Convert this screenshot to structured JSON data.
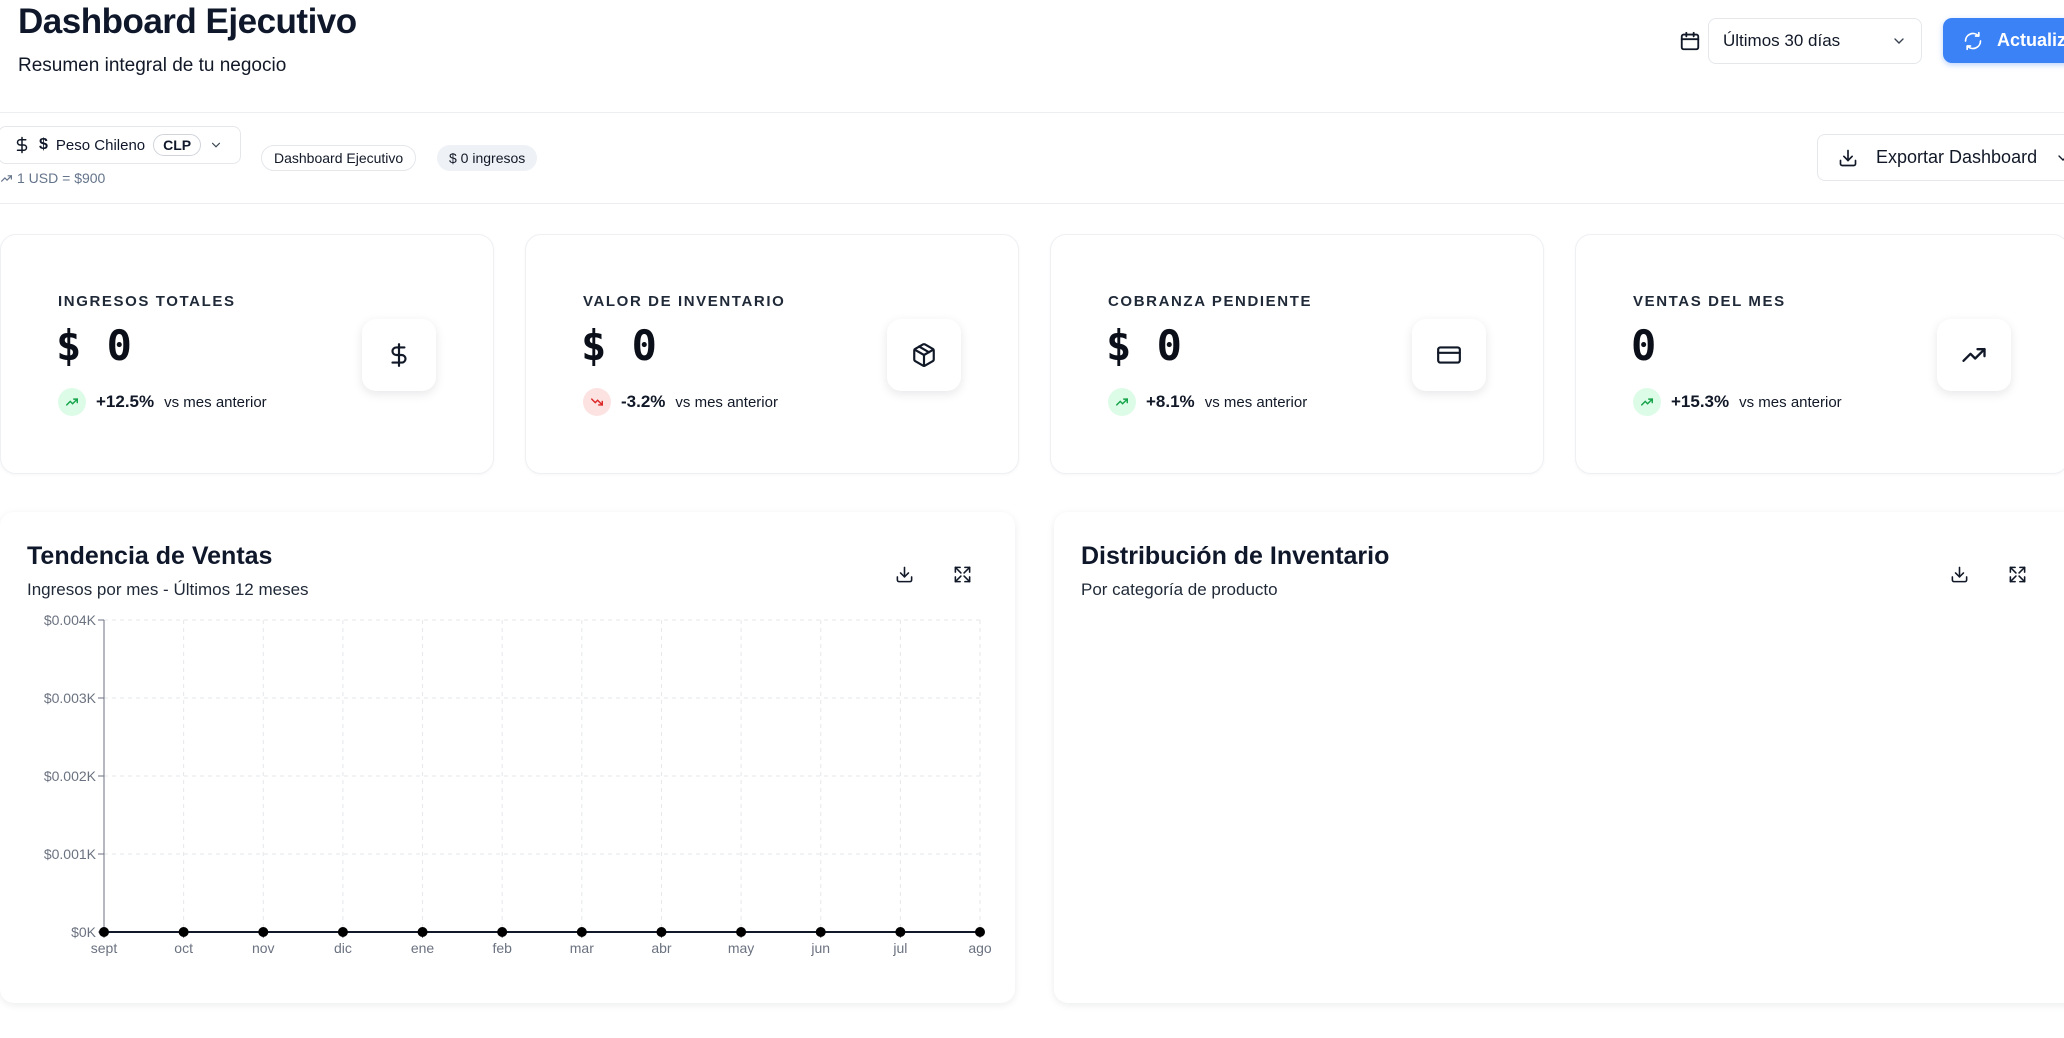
{
  "header": {
    "title": "Dashboard Ejecutivo",
    "subtitle": "Resumen integral de tu negocio",
    "period": "Últimos 30 días",
    "refresh_label": "Actualizar"
  },
  "toolbar": {
    "currency_symbol": "$",
    "currency_name": "Peso Chileno",
    "currency_code": "CLP",
    "rate": "1 USD = $900",
    "badge_dashboard": "Dashboard Ejecutivo",
    "badge_income": "$ 0 ingresos",
    "export_label": "Exportar Dashboard"
  },
  "kpis": [
    {
      "label": "INGRESOS TOTALES",
      "value": "$ 0",
      "change": "+12.5%",
      "direction": "up",
      "caption": "vs mes anterior",
      "icon": "dollar-icon"
    },
    {
      "label": "VALOR DE INVENTARIO",
      "value": "$ 0",
      "change": "-3.2%",
      "direction": "down",
      "caption": "vs mes anterior",
      "icon": "package-icon"
    },
    {
      "label": "COBRANZA PENDIENTE",
      "value": "$ 0",
      "change": "+8.1%",
      "direction": "up",
      "caption": "vs mes anterior",
      "icon": "credit-card-icon"
    },
    {
      "label": "VENTAS DEL MES",
      "value": "0",
      "change": "+15.3%",
      "direction": "up",
      "caption": "vs mes anterior",
      "icon": "trending-up-icon"
    }
  ],
  "colors": {
    "accent": "#3b82f6",
    "trend_up_bg": "#dcfce7",
    "trend_up": "#16a34a",
    "trend_down_bg": "#fde2e2",
    "trend_down": "#dc2626"
  },
  "sales_panel": {
    "title": "Tendencia de Ventas",
    "subtitle": "Ingresos por mes - Últimos 12 meses"
  },
  "inventory_panel": {
    "title": "Distribución de Inventario",
    "subtitle": "Por categoría de producto"
  },
  "chart_data": {
    "type": "line",
    "title": "Tendencia de Ventas",
    "subtitle": "Ingresos por mes - Últimos 12 meses",
    "categories": [
      "sept",
      "oct",
      "nov",
      "dic",
      "ene",
      "feb",
      "mar",
      "abr",
      "may",
      "jun",
      "jul",
      "ago"
    ],
    "values": [
      0,
      0,
      0,
      0,
      0,
      0,
      0,
      0,
      0,
      0,
      0,
      0
    ],
    "y_ticks": [
      "$0K",
      "$0.001K",
      "$0.002K",
      "$0.003K",
      "$0.004K"
    ],
    "ylim": [
      0,
      0.004
    ],
    "grid": true,
    "xlabel": "",
    "ylabel": ""
  }
}
